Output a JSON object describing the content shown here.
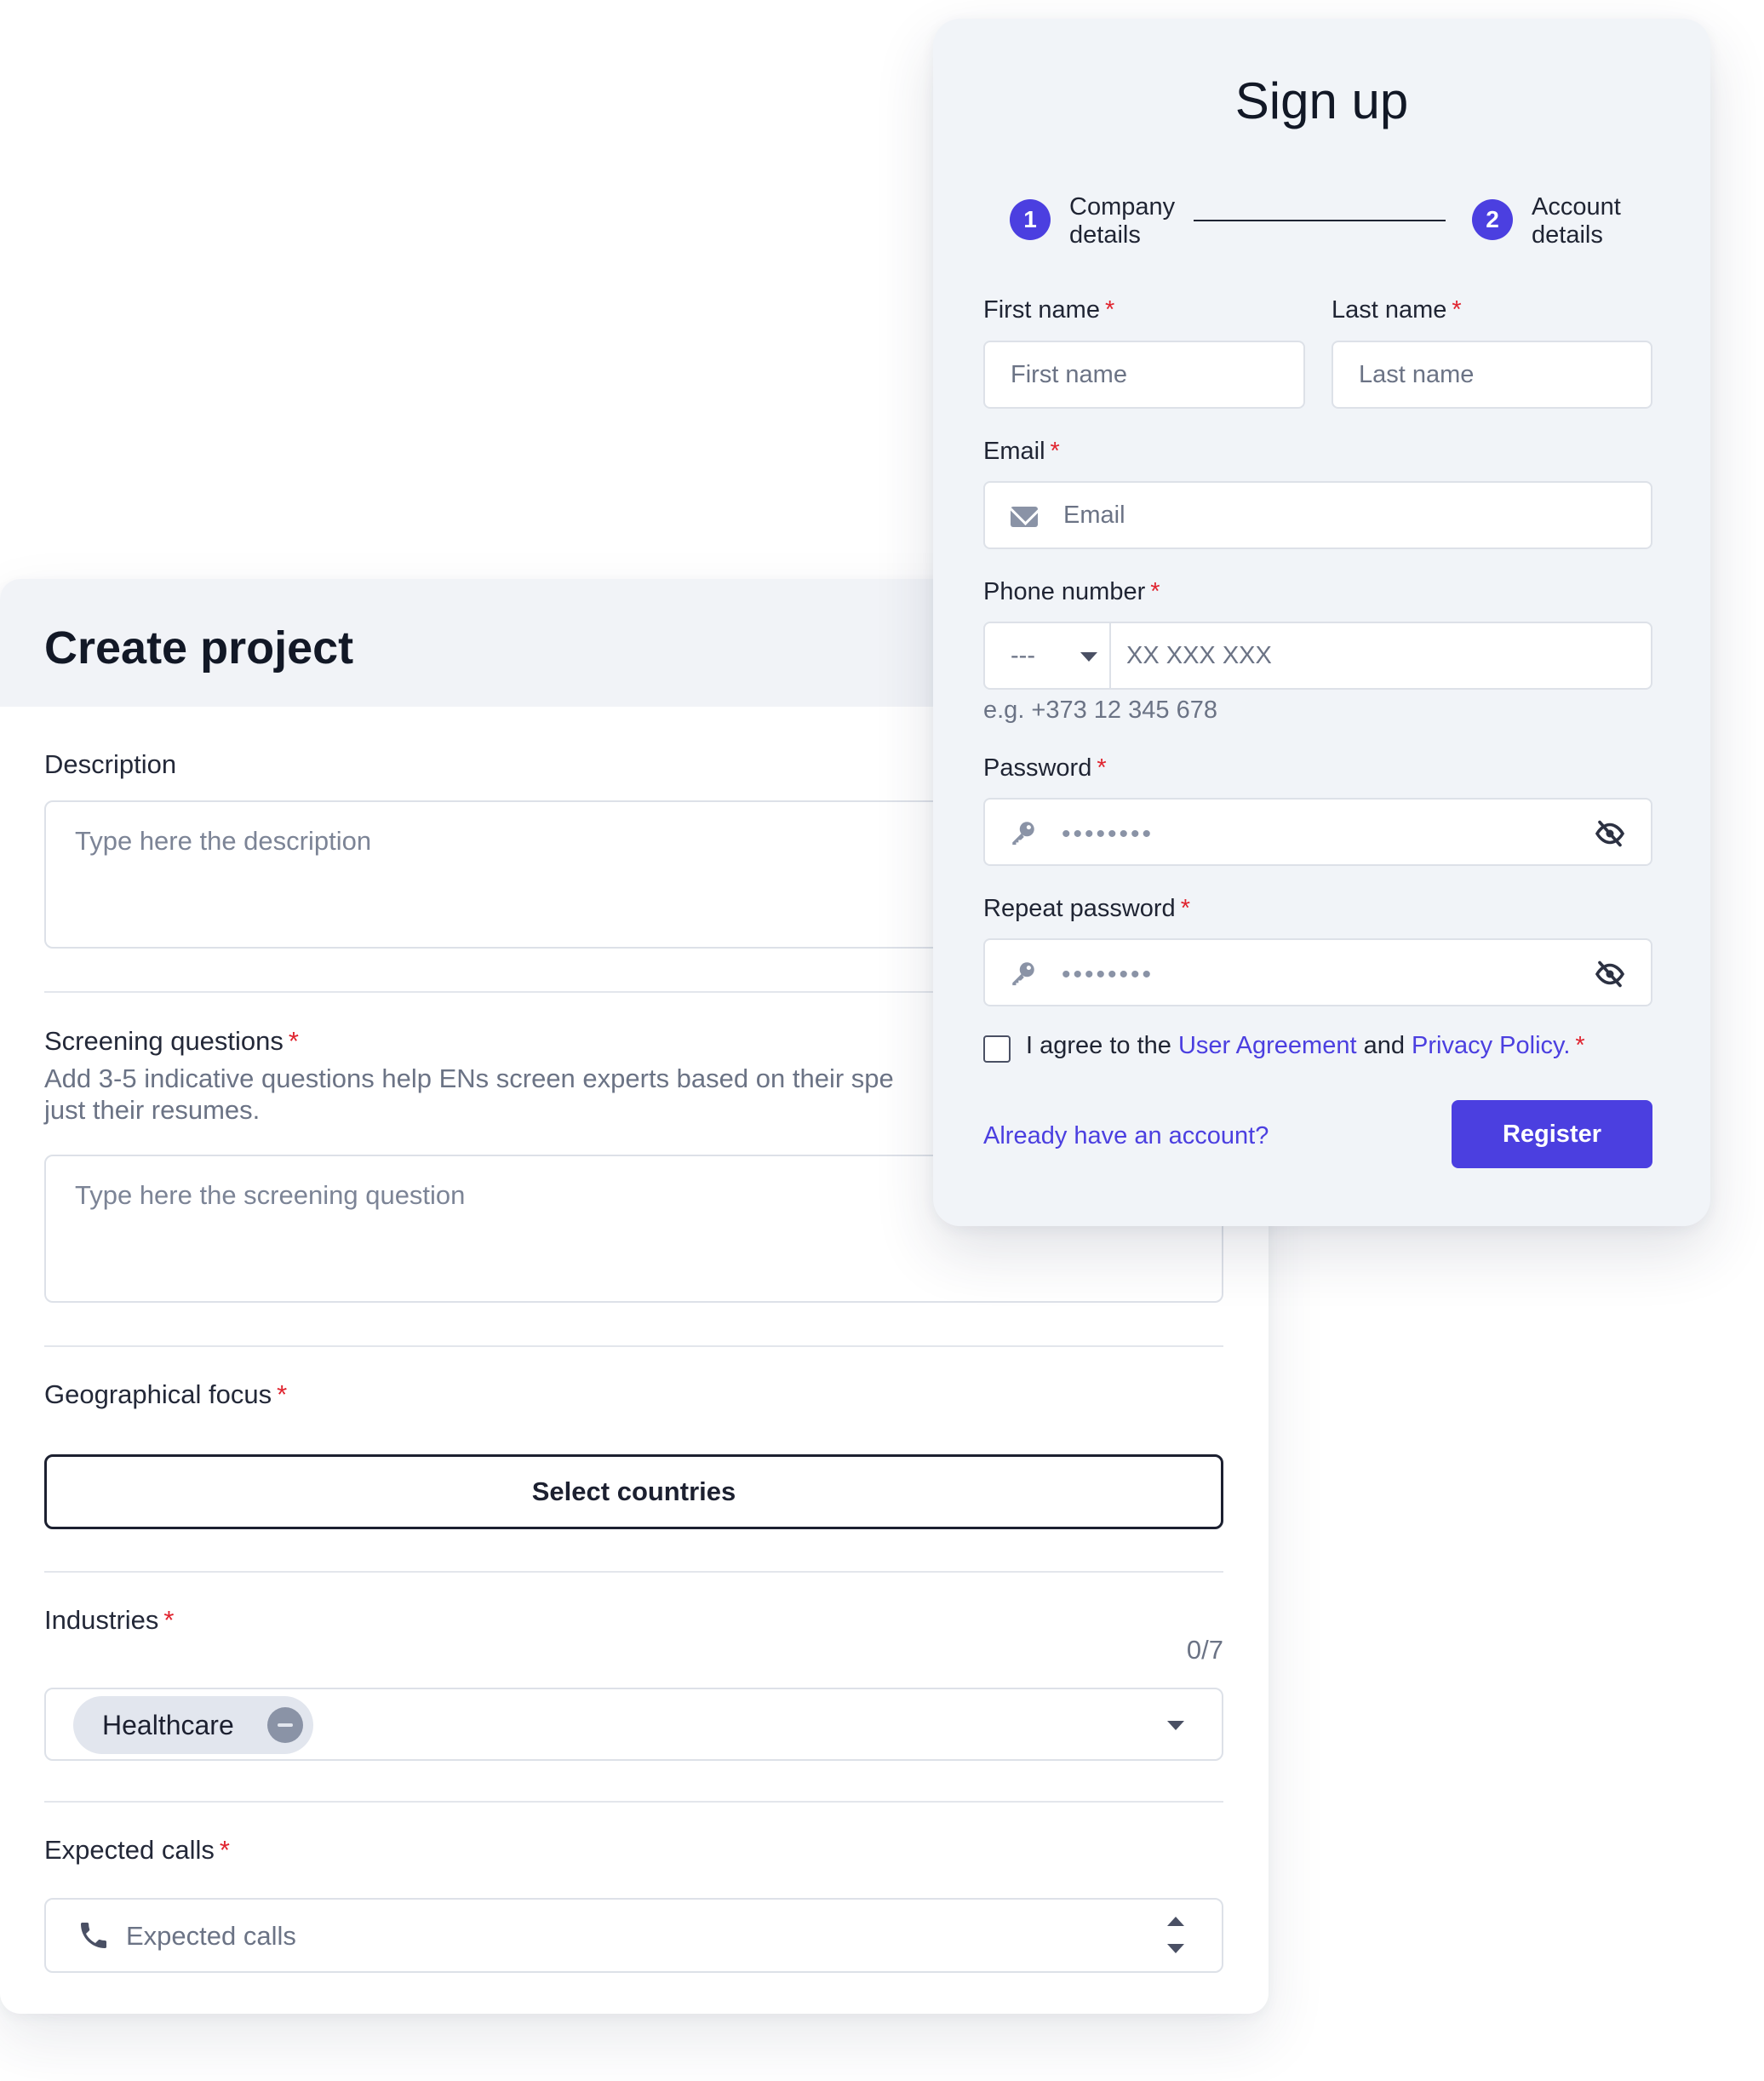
{
  "project": {
    "title": "Create project",
    "description_label": "Description",
    "description_placeholder": "Type here the description",
    "screening_label": "Screening questions",
    "screening_hint": "Add 3-5 indicative questions help ENs screen experts based on their spe just their resumes.",
    "screening_placeholder": "Type here the screening question",
    "geo_label": "Geographical focus",
    "select_countries_label": "Select countries",
    "industries_label": "Industries",
    "industries_counter": "0/7",
    "industry_chip": "Healthcare",
    "expected_calls_label": "Expected calls",
    "expected_calls_placeholder": "Expected calls"
  },
  "signup": {
    "title": "Sign up",
    "steps": [
      {
        "number": "1",
        "label": "Company details"
      },
      {
        "number": "2",
        "label": "Account details"
      }
    ],
    "first_name_label": "First name",
    "first_name_placeholder": "First name",
    "last_name_label": "Last name",
    "last_name_placeholder": "Last name",
    "email_label": "Email",
    "email_placeholder": "Email",
    "phone_label": "Phone number",
    "phone_prefix": "---",
    "phone_placeholder": "XX XXX XXX",
    "phone_hint": "e.g. +373 12 345 678",
    "password_label": "Password",
    "password_value": "••••••••",
    "repeat_password_label": "Repeat password",
    "repeat_password_value": "••••••••",
    "agree_text": "I agree to the",
    "user_agreement": "User Agreement",
    "and_text": "and",
    "privacy_policy": "Privacy Policy.",
    "account_link": "Already have an account?",
    "register_label": "Register"
  },
  "required_marker": "*",
  "colors": {
    "accent": "#4b3fe0",
    "required": "#e0242f",
    "header_bg": "#f1f3f7",
    "card_bg": "#f1f4f8"
  },
  "icons": [
    "envelope-icon",
    "phone-icon",
    "key-icon",
    "eye-off-icon",
    "caret-down-icon",
    "caret-up-icon",
    "minus-circle-icon"
  ]
}
